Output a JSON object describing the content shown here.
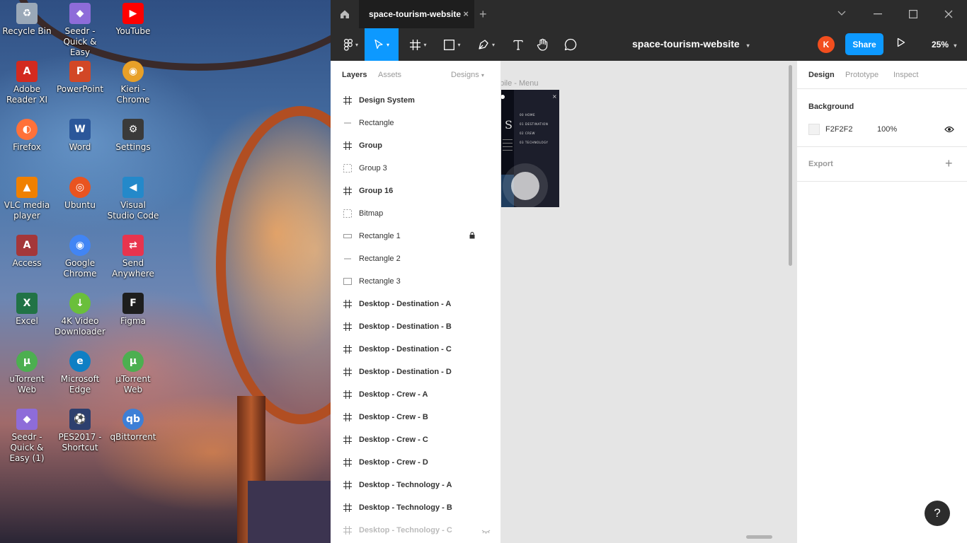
{
  "desktop": {
    "icons": [
      {
        "label": "Recycle Bin",
        "icon": "recycle-bin-icon",
        "color": "#9aa8b8"
      },
      {
        "label": "Seedr - Quick & Easy",
        "icon": "seedr-icon",
        "color": "#8e6cd9"
      },
      {
        "label": "YouTube",
        "icon": "youtube-icon",
        "color": "#ff0000"
      },
      {
        "label": "Adobe Reader XI",
        "icon": "adobe-reader-icon",
        "color": "#d32a1f"
      },
      {
        "label": "PowerPoint",
        "icon": "powerpoint-icon",
        "color": "#d24726"
      },
      {
        "label": "Kieri - Chrome",
        "icon": "chrome-profile-icon",
        "color": "#e8a028"
      },
      {
        "label": "Firefox",
        "icon": "firefox-icon",
        "color": "#ff7139"
      },
      {
        "label": "Word",
        "icon": "word-icon",
        "color": "#2b579a"
      },
      {
        "label": "Settings",
        "icon": "settings-icon",
        "color": "#3a3a3a"
      },
      {
        "label": "VLC media player",
        "icon": "vlc-icon",
        "color": "#f08000"
      },
      {
        "label": "Ubuntu",
        "icon": "ubuntu-icon",
        "color": "#e95420"
      },
      {
        "label": "Visual Studio Code",
        "icon": "vscode-icon",
        "color": "#2489ca"
      },
      {
        "label": "Access",
        "icon": "access-icon",
        "color": "#a4373a"
      },
      {
        "label": "Google Chrome",
        "icon": "chrome-icon",
        "color": "#4285f4"
      },
      {
        "label": "Send Anywhere",
        "icon": "send-anywhere-icon",
        "color": "#e8344e"
      },
      {
        "label": "Excel",
        "icon": "excel-icon",
        "color": "#217346"
      },
      {
        "label": "4K Video Downloader",
        "icon": "video-downloader-icon",
        "color": "#6abf3b"
      },
      {
        "label": "Figma",
        "icon": "figma-icon",
        "color": "#1e1e1e"
      },
      {
        "label": "uTorrent Web",
        "icon": "utorrent-icon",
        "color": "#4caf50"
      },
      {
        "label": "Microsoft Edge",
        "icon": "edge-icon",
        "color": "#0f7fc4"
      },
      {
        "label": "µTorrent Web",
        "icon": "utorrent-web-icon",
        "color": "#4caf50"
      },
      {
        "label": "Seedr - Quick & Easy (1)",
        "icon": "seedr-icon-2",
        "color": "#8e6cd9"
      },
      {
        "label": "PES2017 - Shortcut",
        "icon": "pes-icon",
        "color": "#2d3f6e"
      },
      {
        "label": "qBittorrent",
        "icon": "qbittorrent-icon",
        "color": "#3d7fd6"
      }
    ]
  },
  "titlebar": {
    "tab_title": "space-tourism-website",
    "tab_close": "×",
    "new_tab": "+"
  },
  "toolbar": {
    "document_title": "space-tourism-website",
    "avatar_initial": "K",
    "share_label": "Share",
    "zoom": "25%"
  },
  "layers_panel": {
    "tabs": [
      "Layers",
      "Assets"
    ],
    "page_selector": "Designs",
    "layers": [
      {
        "name": "Design System",
        "icon": "frame-icon",
        "kind": "frame"
      },
      {
        "name": "Rectangle",
        "icon": "line-icon",
        "kind": "shape"
      },
      {
        "name": "Group",
        "icon": "frame-icon",
        "kind": "frame"
      },
      {
        "name": "Group 3",
        "icon": "group-icon",
        "kind": "shape"
      },
      {
        "name": "Group 16",
        "icon": "frame-icon",
        "kind": "frame"
      },
      {
        "name": "Bitmap",
        "icon": "group-icon",
        "kind": "shape"
      },
      {
        "name": "Rectangle 1",
        "icon": "thin-rect-icon",
        "kind": "shape",
        "locked": true
      },
      {
        "name": "Rectangle 2",
        "icon": "line-icon",
        "kind": "shape"
      },
      {
        "name": "Rectangle 3",
        "icon": "rect-icon",
        "kind": "shape"
      },
      {
        "name": "Desktop - Destination - A",
        "icon": "frame-icon",
        "kind": "frame"
      },
      {
        "name": "Desktop - Destination - B",
        "icon": "frame-icon",
        "kind": "frame"
      },
      {
        "name": "Desktop - Destination - C",
        "icon": "frame-icon",
        "kind": "frame"
      },
      {
        "name": "Desktop - Destination - D",
        "icon": "frame-icon",
        "kind": "frame"
      },
      {
        "name": "Desktop - Crew - A",
        "icon": "frame-icon",
        "kind": "frame"
      },
      {
        "name": "Desktop - Crew -  B",
        "icon": "frame-icon",
        "kind": "frame"
      },
      {
        "name": "Desktop - Crew -  C",
        "icon": "frame-icon",
        "kind": "frame"
      },
      {
        "name": "Desktop - Crew -  D",
        "icon": "frame-icon",
        "kind": "frame"
      },
      {
        "name": "Desktop - Technology - A",
        "icon": "frame-icon",
        "kind": "frame"
      },
      {
        "name": "Desktop - Technology - B",
        "icon": "frame-icon",
        "kind": "frame"
      },
      {
        "name": "Desktop - Technology - C",
        "icon": "frame-icon",
        "kind": "frame",
        "hidden": true
      }
    ]
  },
  "canvas": {
    "frame_label": "obile - Menu",
    "frame_menu_items": [
      "00 HOME",
      "01 DESTINATION",
      "02 CREW",
      "03 TECHNOLOGY"
    ]
  },
  "right_panel": {
    "tabs": [
      "Design",
      "Prototype",
      "Inspect"
    ],
    "background_title": "Background",
    "background_hex": "F2F2F2",
    "background_opacity": "100%",
    "export_title": "Export",
    "export_add": "+",
    "help": "?"
  },
  "colors": {
    "accent": "#0d99ff",
    "toolbar_bg": "#2c2c2c",
    "canvas_bg": "#e5e5e5",
    "avatar": "#f24e1e"
  }
}
